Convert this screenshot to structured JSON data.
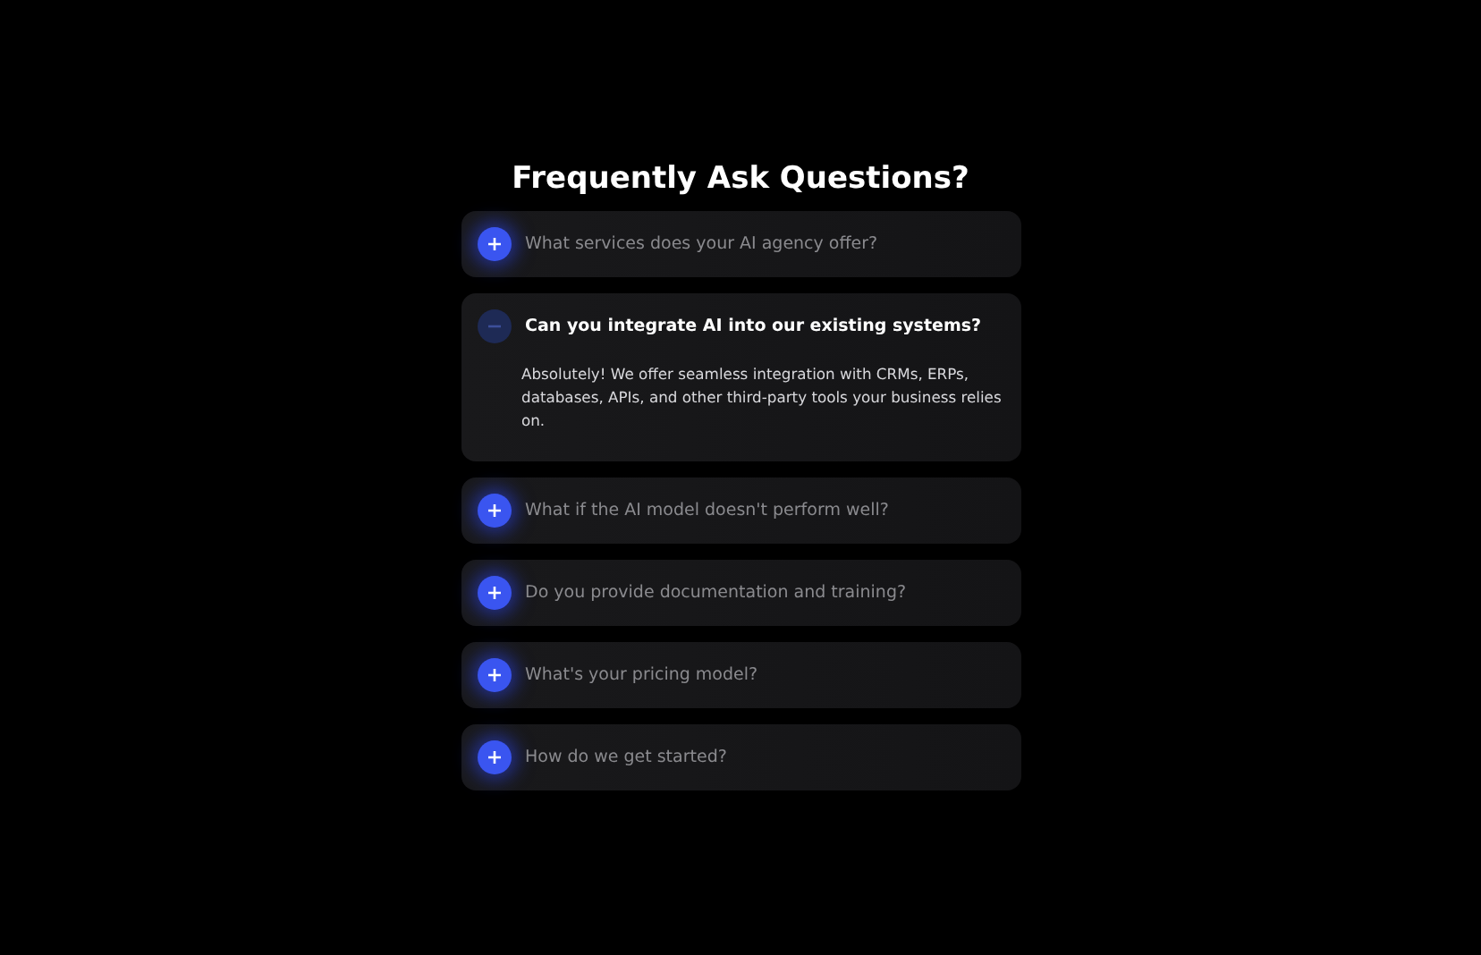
{
  "title": "Frequently Ask Questions?",
  "faqs": [
    {
      "question": "What services does your AI agency offer?",
      "expanded": false
    },
    {
      "question": "Can you integrate AI into our existing systems?",
      "expanded": true,
      "answer": "Absolutely! We offer seamless integration with CRMs, ERPs, databases, APIs, and other third-party tools your business relies on."
    },
    {
      "question": "What if the AI model doesn't perform well?",
      "expanded": false
    },
    {
      "question": "Do you provide documentation and training?",
      "expanded": false
    },
    {
      "question": "What's your pricing model?",
      "expanded": false
    },
    {
      "question": "How do we get started?",
      "expanded": false
    }
  ]
}
